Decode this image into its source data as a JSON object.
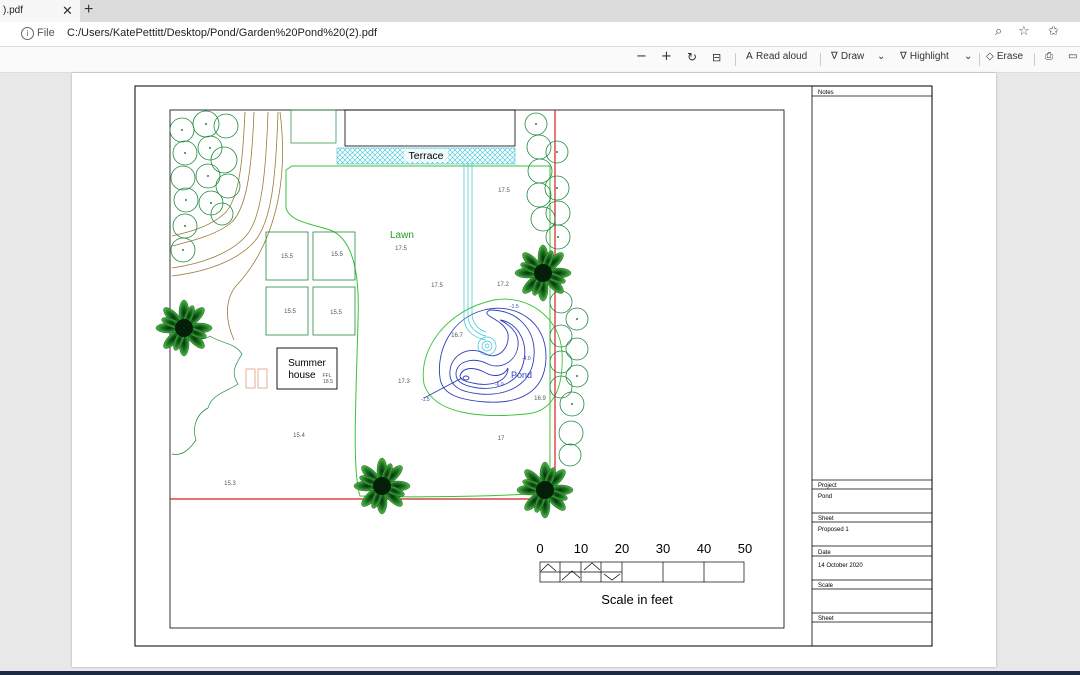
{
  "browser": {
    "tab_title": ").pdf",
    "file_label": "File",
    "url": "C:/Users/KatePettitt/Desktop/Pond/Garden%20Pond%20(2).pdf"
  },
  "pdf_toolbar": {
    "read_aloud": "Read aloud",
    "draw": "Draw",
    "highlight": "Highlight",
    "erase": "Erase"
  },
  "plan": {
    "labels": {
      "terrace": "Terrace",
      "lawn": "Lawn",
      "summer_house_1": "Summer",
      "summer_house_2": "house",
      "ffl": "FFL",
      "ffl_level": "18.5",
      "pond": "Pond"
    },
    "levels": {
      "l_17_5_a": "17.5",
      "l_17_5_b": "17.5",
      "l_17_5_c": "17.5",
      "l_17_2": "17.2",
      "l_16_7": "16.7",
      "l_17_3": "17.3",
      "l_16_9": "16.9",
      "l_17": "17",
      "l_15_4": "15.4",
      "l_15_3": "15.3",
      "bed_1": "15.5",
      "bed_2": "15.5",
      "bed_3": "15.5",
      "bed_4": "15.5",
      "depth_1": "-1.5",
      "depth_2": "-4.0",
      "depth_3": "-6.0",
      "depth_4": "-1.5"
    },
    "scale": {
      "ticks": [
        "0",
        "10",
        "20",
        "30",
        "40",
        "50"
      ],
      "caption": "Scale in feet"
    }
  },
  "title_block": {
    "notes_label": "Notes",
    "project_label": "Project",
    "project_value": "Pond",
    "sheet_label": "Sheet",
    "sheet_value": "Proposed 1",
    "date_label": "Date",
    "date_value": "14 October 2020",
    "scale_label": "Scale",
    "sheet2_label": "Sheet"
  }
}
